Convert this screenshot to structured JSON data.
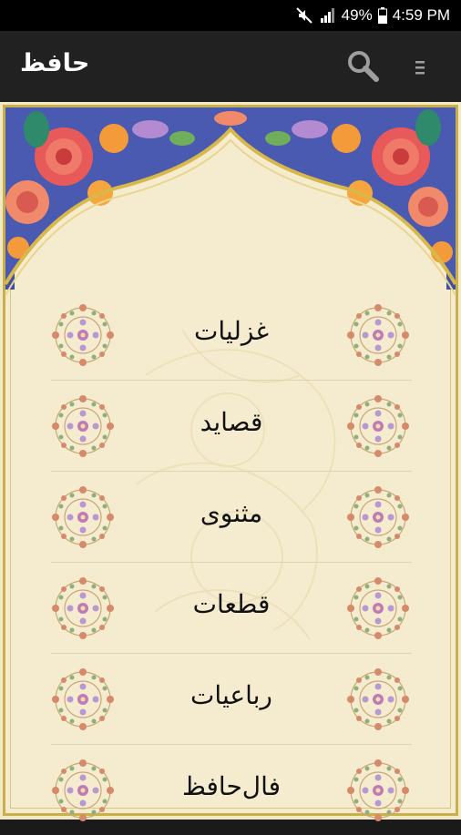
{
  "status_bar": {
    "battery_percent": "49%",
    "time": "4:59 PM",
    "icons": [
      "mute-icon",
      "signal-icon",
      "battery-icon"
    ]
  },
  "app_bar": {
    "title": "حافظ",
    "search_icon": "search-icon",
    "menu_icon": "overflow-menu-icon"
  },
  "menu": {
    "items": [
      {
        "label": "غزلیات"
      },
      {
        "label": "قصاید"
      },
      {
        "label": "مثنوی"
      },
      {
        "label": "قطعات"
      },
      {
        "label": "رباعیات"
      },
      {
        "label": "فال‌حافظ"
      }
    ]
  },
  "colors": {
    "status_bar": "#000000",
    "app_bar": "#212121",
    "parchment": "#f5ecd0",
    "frame_gold": "#c9b04a",
    "border_blue": "#3f4fa6"
  }
}
